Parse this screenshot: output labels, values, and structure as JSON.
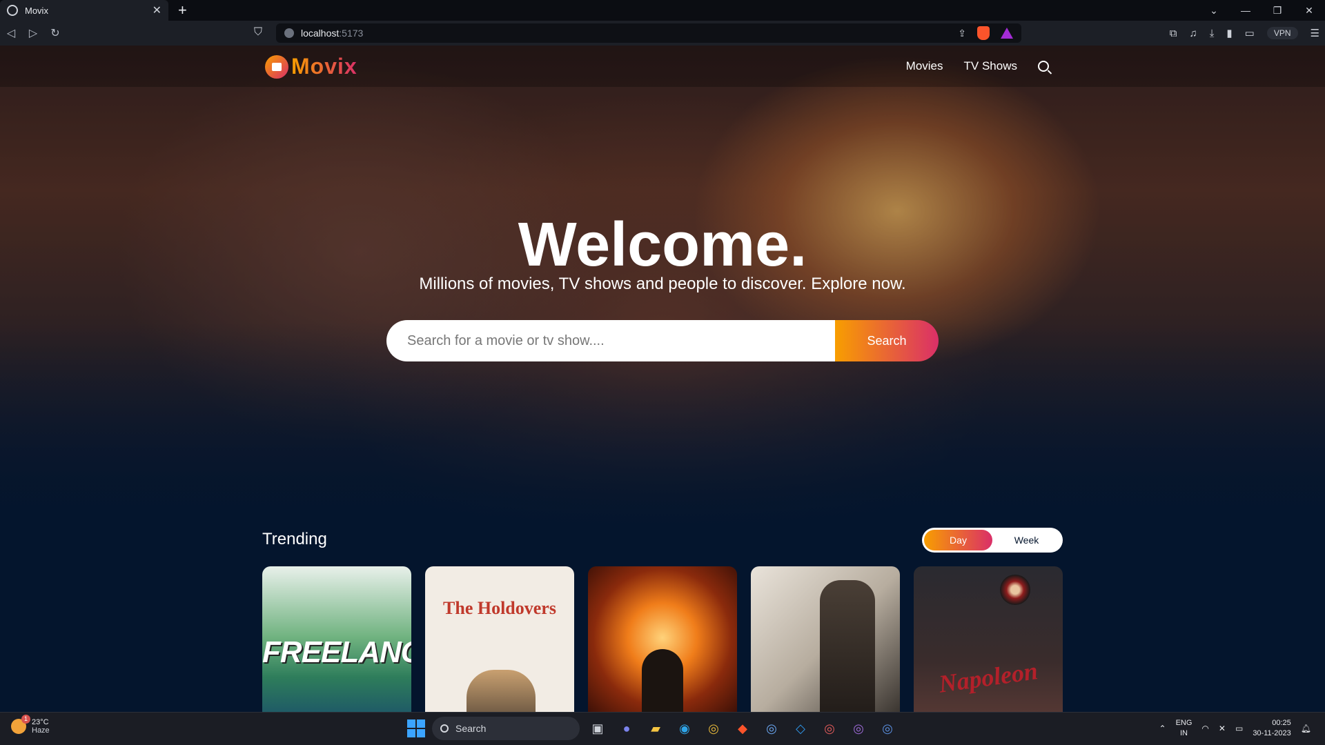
{
  "browser": {
    "tab_title": "Movix",
    "new_tab": "+",
    "url_host": "localhost",
    "url_port": ":5173",
    "vpn_label": "VPN"
  },
  "app": {
    "logo": "Movix",
    "menu": [
      {
        "label": "Movies"
      },
      {
        "label": "TV Shows"
      }
    ]
  },
  "hero": {
    "title": "Welcome.",
    "subtitle": "Millions of movies, TV shows and people to discover. Explore now.",
    "search_placeholder": "Search for a movie or tv show....",
    "search_button": "Search"
  },
  "trending": {
    "title": "Trending",
    "tabs": [
      "Day",
      "Week"
    ],
    "active_tab": "Day",
    "cards": [
      {
        "caption": "FREELANCE"
      },
      {
        "caption": "The Holdovers"
      },
      {
        "caption": ""
      },
      {
        "caption": ""
      },
      {
        "caption": "Napoleon"
      }
    ]
  },
  "taskbar": {
    "temperature": "23°C",
    "weather": "Haze",
    "weather_badge": "1",
    "search_label": "Search",
    "lang_top": "ENG",
    "lang_bottom": "IN",
    "time": "00:25",
    "date": "30-11-2023"
  },
  "colors": {
    "accent_start": "#f89e00",
    "accent_end": "#da2f68",
    "background": "#04152d"
  }
}
